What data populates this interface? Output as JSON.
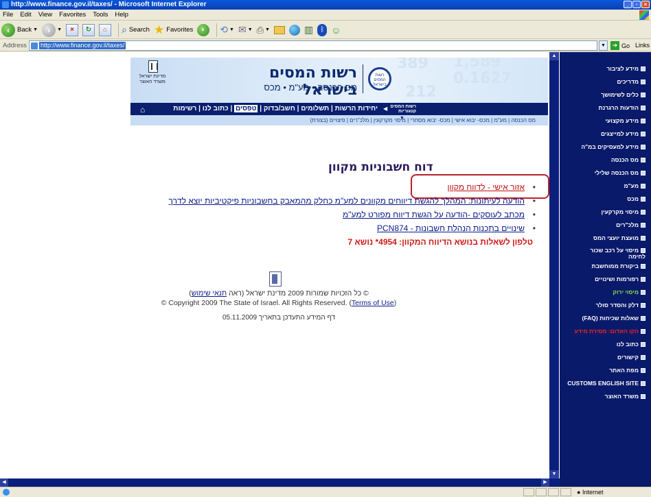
{
  "window": {
    "title": "http://www.finance.gov.il/taxes/ - Microsoft Internet Explorer"
  },
  "menu": [
    "File",
    "Edit",
    "View",
    "Favorites",
    "Tools",
    "Help"
  ],
  "toolbar": {
    "back": "Back",
    "search": "Search",
    "favorites": "Favorites"
  },
  "address": {
    "label": "Address",
    "url": "http://www.finance.gov.il/taxes/",
    "go": "Go",
    "links": "Links"
  },
  "banner": {
    "title": "רשות המסים בישראל",
    "subtitle": "מס הכנסה • מע\"מ • מכס",
    "logo_text": "רשות המסים בישראל",
    "emblem_text": "מדינת ישראל משרד האוצר",
    "bg_numbers": [
      "389",
      "1,589",
      "0.1627",
      "212"
    ]
  },
  "nav_main": {
    "shortcut": "רשות המסים קטגוריות",
    "items": [
      "יחידות הרשות",
      "תשלומים",
      "חשב/בדוק",
      "טפסים",
      "כתוב לנו",
      "רשימות תפוצה"
    ],
    "active": "טפסים"
  },
  "nav_sub": [
    "מס הכנסה",
    "מע\"מ",
    "מכס- יבוא אישי",
    "מכס- יבוא מסחרי",
    "מיסוי מקרקעין",
    "מלכ\"רים",
    "פיצויים (בצורת)"
  ],
  "main": {
    "title": "דוח חשבוניות מקוון",
    "links": [
      {
        "text": "אזור אישי - לדווח מקוון",
        "style": "red"
      },
      {
        "text": "הודעה לעיתונות: המהלך להגשת דיווחים מקוונים למע\"מ כחלק מהמאבק בחשבוניות פיקטיביות יוצא לדרך",
        "style": "blue"
      },
      {
        "text": "מכתב לעוסקים -הודעה על הגשת דיווח מפורט למע\"מ",
        "style": "blue"
      },
      {
        "text": "שינויים בתכנות הנהלת חשבונות - PCN874",
        "style": "blue"
      }
    ],
    "phone": "טלפון לשאלות בנושא הדיווח המקוון: 4954* נושא 7"
  },
  "footer": {
    "copyright_he_prefix": "© כל הזכויות שמורות 2009 מדינת ישראל (ראה ",
    "copyright_he_link": "תנאי שימוש",
    "copyright_he_suffix": ")",
    "copyright_en_prefix": "© Copyright 2009 The State of Israel. All Rights Reserved. (",
    "copyright_en_link": "Terms of Use",
    "copyright_en_suffix": ")",
    "updated": "דף המידע התעדכן בתאריך 05.11.2009"
  },
  "sidebar": [
    {
      "label": "מידע לציבור",
      "style": "white"
    },
    {
      "label": "מדריכים",
      "style": "white"
    },
    {
      "label": "כלים לשימושך",
      "style": "white"
    },
    {
      "label": "הודעות הרגרנת",
      "style": "white"
    },
    {
      "label": "מידע מקצועי",
      "style": "white"
    },
    {
      "label": "מידע למייצגים",
      "style": "white"
    },
    {
      "label": "מידע למעסיקים במ\"ה",
      "style": "white"
    },
    {
      "label": "מס הכנסה",
      "style": "white"
    },
    {
      "label": "מס הכנסה שלילי",
      "style": "white"
    },
    {
      "label": "מע\"מ",
      "style": "white"
    },
    {
      "label": "מכס",
      "style": "white"
    },
    {
      "label": "מיסוי מקרקעין",
      "style": "white"
    },
    {
      "label": "מלכ\"רים",
      "style": "white"
    },
    {
      "label": "מועצת יועצי המס",
      "style": "white"
    },
    {
      "label": "מיסוי על רכב שכור",
      "style": "white",
      "tall": true,
      "line2": "לחימה"
    },
    {
      "label": "ביקורת ממוחשבת",
      "style": "white"
    },
    {
      "label": "רפורמות ושינויים",
      "style": "white"
    },
    {
      "label": "מיסוי ירוק",
      "style": "green"
    },
    {
      "label": "דלק והסדר סולר",
      "style": "white"
    },
    {
      "label": "שאלות שכיחות (FAQ)",
      "style": "white"
    },
    {
      "label": "הקו האדום: מסירת מידע",
      "style": "red"
    },
    {
      "label": "כתוב לנו",
      "style": "white"
    },
    {
      "label": "קישורים",
      "style": "white"
    },
    {
      "label": "מפת האתר",
      "style": "white"
    },
    {
      "label": "CUSTOMS ENGLISH SITE",
      "style": "white"
    },
    {
      "label": "משרד האוצר",
      "style": "white"
    }
  ],
  "status": {
    "zone": "Internet"
  }
}
